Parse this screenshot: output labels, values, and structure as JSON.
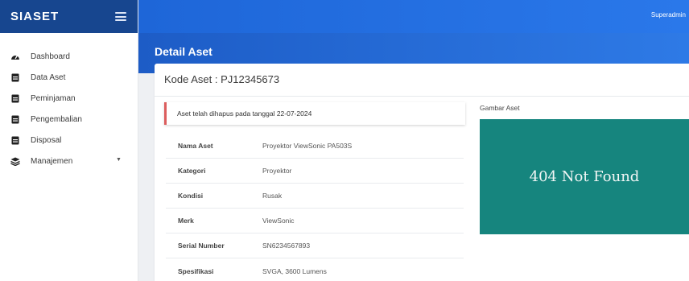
{
  "brand": {
    "name": "SIASET"
  },
  "topbar": {
    "user": "Superadmin"
  },
  "sidebar": {
    "items": [
      {
        "label": "Dashboard",
        "icon": "dashboard-gauge-icon"
      },
      {
        "label": "Data Aset",
        "icon": "document-icon"
      },
      {
        "label": "Peminjaman",
        "icon": "document-icon"
      },
      {
        "label": "Pengembalian",
        "icon": "document-icon"
      },
      {
        "label": "Disposal",
        "icon": "document-icon"
      },
      {
        "label": "Manajemen",
        "icon": "layers-icon",
        "has_submenu": true
      }
    ]
  },
  "page": {
    "title": "Detail Aset"
  },
  "card": {
    "title": "Kode Aset : PJ12345673",
    "alert": "Aset telah dihapus pada tanggal 22-07-2024",
    "details": [
      {
        "label": "Nama Aset",
        "value": "Proyektor ViewSonic PA503S"
      },
      {
        "label": "Kategori",
        "value": "Proyektor"
      },
      {
        "label": "Kondisi",
        "value": "Rusak"
      },
      {
        "label": "Merk",
        "value": "ViewSonic"
      },
      {
        "label": "Serial Number",
        "value": "SN6234567893"
      },
      {
        "label": "Spesifikasi",
        "value": "SVGA, 3600 Lumens"
      }
    ],
    "image": {
      "label": "Gambar Aset",
      "text": "404 Not Found"
    }
  },
  "colors": {
    "brand_bg": "#17468f",
    "topbar": "#2a78ea",
    "alert_accent": "#dc5e5e",
    "image_bg": "#16857e"
  }
}
